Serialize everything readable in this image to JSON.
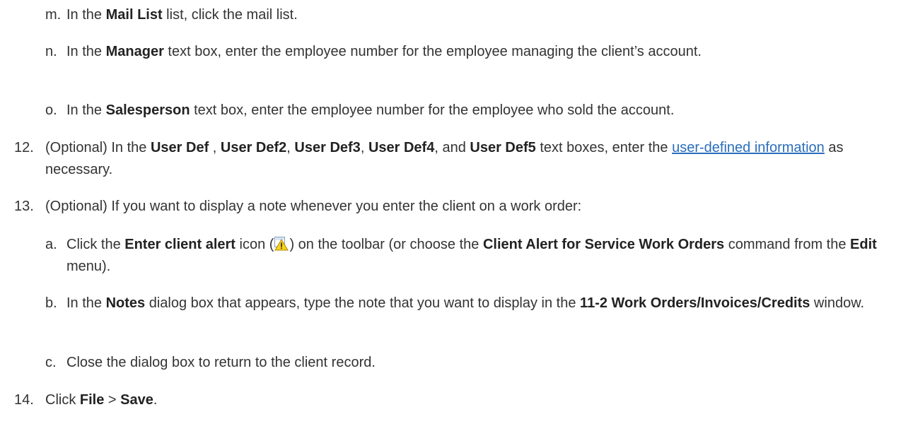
{
  "steps": {
    "m": {
      "marker": "m.",
      "t1": "In the ",
      "b1": "Mail List",
      "t2": " list, click the mail list."
    },
    "n": {
      "marker": "n.",
      "t1": "In the ",
      "b1": "Manager",
      "t2": " text box, enter the employee number for the employee managing the client’s account."
    },
    "o": {
      "marker": "o.",
      "t1": "In the ",
      "b1": "Salesperson",
      "t2": " text box, enter the employee number for the employee who sold the account."
    },
    "s12": {
      "marker": "12.",
      "t1": "(Optional) In the ",
      "b1": "User Def",
      "t2": " , ",
      "b2": "User Def2",
      "t3": ", ",
      "b3": "User Def3",
      "t4": ", ",
      "b4": "User Def4",
      "t5": ", and ",
      "b5": "User Def5",
      "t6": " text boxes, enter the ",
      "link": "user-defined information",
      "t7": " as necessary."
    },
    "s13": {
      "marker": "13.",
      "t1": "(Optional) If you want to display a note whenever you enter the client on a work order:"
    },
    "a": {
      "marker": "a.",
      "t1": "Click the ",
      "b1": "Enter client alert",
      "t2": " icon (",
      "t3": ") on the toolbar (or choose the ",
      "b2": "Client Alert for Service Work Orders",
      "t4": " command from the ",
      "b3": "Edit",
      "t5": " menu).",
      "icon": "client-alert-icon"
    },
    "b": {
      "marker": "b.",
      "t1": "In the ",
      "b1": "Notes",
      "t2": " dialog box that appears, type the note that you want to display in the ",
      "b2": "11-2 Work Orders/Invoices/Credits",
      "t3": " window."
    },
    "c": {
      "marker": "c.",
      "t1": "Close the dialog box to return to the client record."
    },
    "s14": {
      "marker": "14.",
      "t1": "Click ",
      "b1": "File",
      "t2": " > ",
      "b2": "Save",
      "t3": "."
    }
  },
  "colors": {
    "text": "#333333",
    "link": "#2a6ebb"
  }
}
